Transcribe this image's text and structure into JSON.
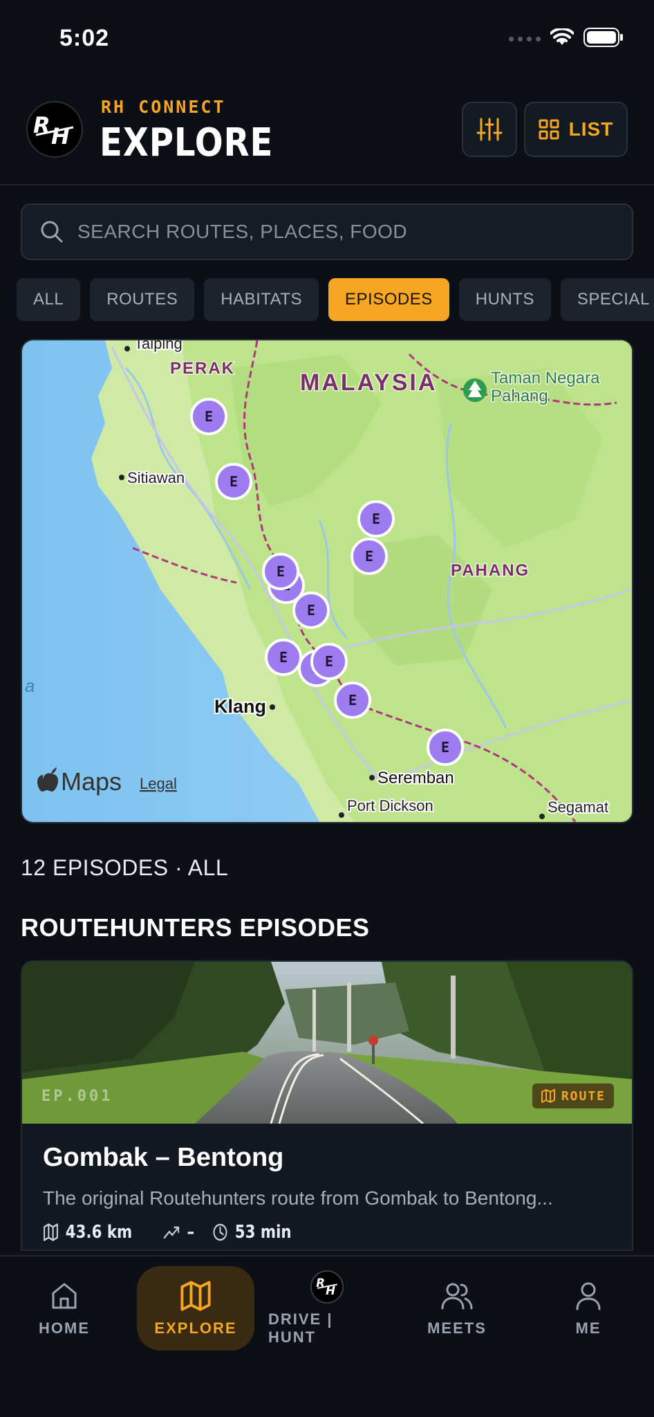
{
  "status_bar": {
    "time": "5:02"
  },
  "header": {
    "subtitle": "RH CONNECT",
    "title": "EXPLORE",
    "list_label": "LIST"
  },
  "search": {
    "placeholder": "SEARCH ROUTES, PLACES, FOOD"
  },
  "chips": [
    {
      "label": "ALL",
      "active": false
    },
    {
      "label": "ROUTES",
      "active": false
    },
    {
      "label": "HABITATS",
      "active": false
    },
    {
      "label": "EPISODES",
      "active": true
    },
    {
      "label": "HUNTS",
      "active": false
    },
    {
      "label": "SPECIAL S",
      "active": false
    }
  ],
  "map": {
    "labels": {
      "country": "MALAYSIA",
      "state1": "PERAK",
      "state2": "PAHANG",
      "park_line1": "Taman Negara",
      "park_line2": "Pahang",
      "city_taiping": "Taiping",
      "city_sitiawan": "Sitiawan",
      "city_klang": "Klang",
      "city_seremban": "Seremban",
      "city_port_dickson": "Port Dickson",
      "city_segamat": "Segamat",
      "sea_letter": "a"
    },
    "marker_letter": "E",
    "attribution": "Maps",
    "legal": "Legal"
  },
  "results": {
    "count_line": "12 EPISODES · ALL",
    "section_title": "ROUTEHUNTERS EPISODES"
  },
  "episode": {
    "tag": "EP.001",
    "badge": "ROUTE",
    "title": "Gombak – Bentong",
    "description": "The original Routehunters route from Gombak to Bentong...",
    "distance": "43.6 km",
    "elevation": "–",
    "duration": "53 min"
  },
  "nav": {
    "home": "HOME",
    "explore": "EXPLORE",
    "drive": "DRIVE | HUNT",
    "meets": "MEETS",
    "me": "ME"
  },
  "colors": {
    "accent": "#f5a623",
    "marker": "#9d7cf0",
    "background": "#0c1016"
  }
}
